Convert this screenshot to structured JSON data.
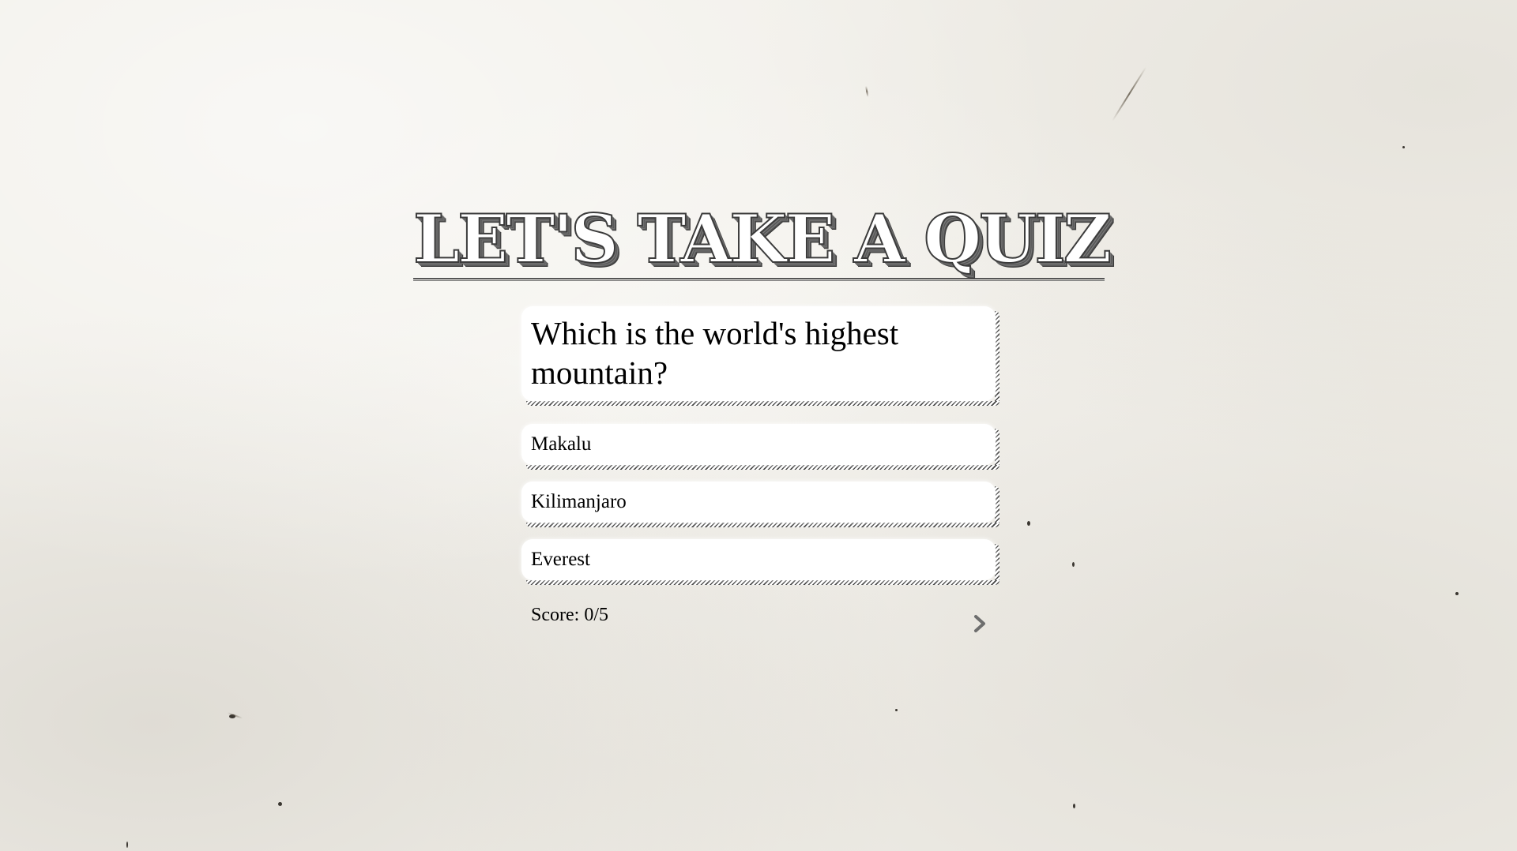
{
  "title": "LET'S TAKE A QUIZ",
  "question": {
    "text": "Which is the world's highest mountain?"
  },
  "answers": [
    {
      "label": "Makalu"
    },
    {
      "label": "Kilimanjaro"
    },
    {
      "label": "Everest"
    }
  ],
  "score": {
    "text": "Score: 0/5"
  },
  "next_button": {
    "icon": "chevron-right-icon"
  },
  "colors": {
    "background": "#f1efe9",
    "card": "#ffffff",
    "hatch": "#444444",
    "title_stroke": "#3c3c3c"
  }
}
